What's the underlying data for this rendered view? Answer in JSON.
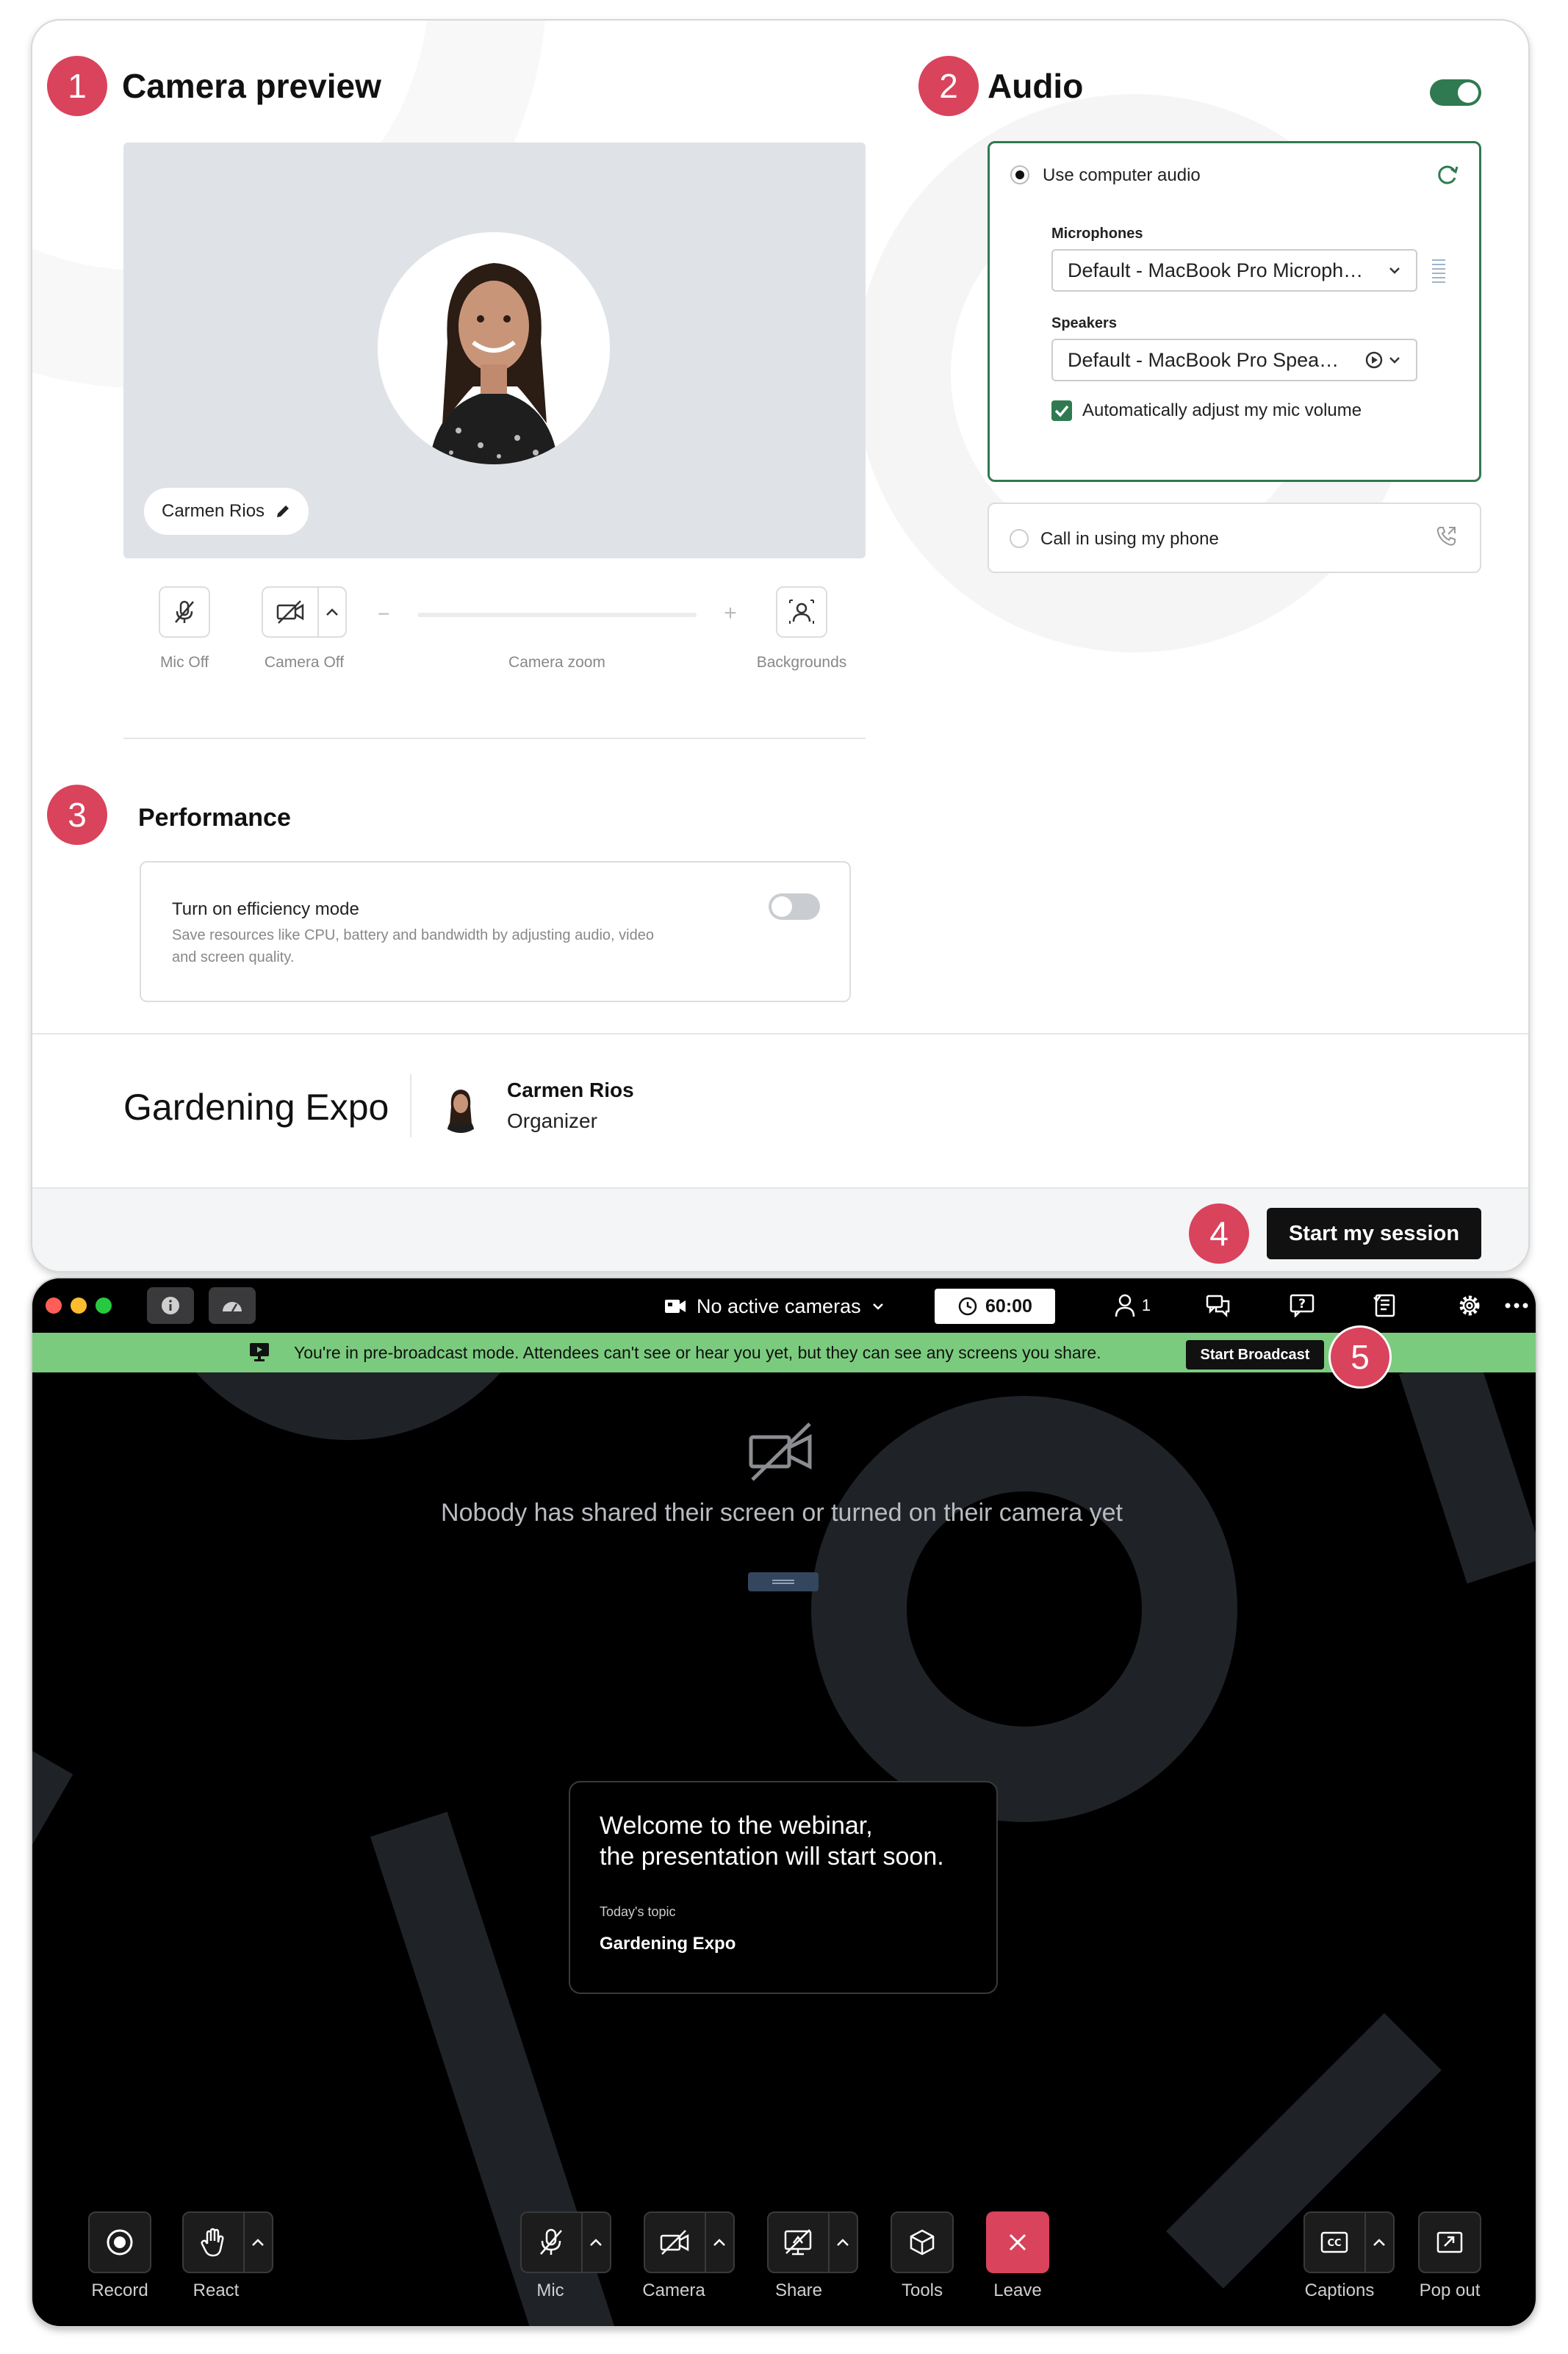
{
  "camera": {
    "badge": "1",
    "title": "Camera preview",
    "name": "Carmen Rios",
    "mic_label": "Mic Off",
    "camera_label": "Camera Off",
    "zoom_label": "Camera zoom",
    "zoom_minus": "−",
    "zoom_plus": "+",
    "backgrounds_label": "Backgrounds"
  },
  "audio": {
    "badge": "2",
    "title": "Audio",
    "enabled": true,
    "use_computer_audio": "Use computer audio",
    "microphones_label": "Microphones",
    "microphone_value": "Default - MacBook Pro Microph…",
    "speakers_label": "Speakers",
    "speaker_value": "Default - MacBook Pro Spea…",
    "auto_adjust": "Automatically adjust my mic volume",
    "auto_adjust_checked": true,
    "call_in": "Call in using my phone"
  },
  "performance": {
    "badge": "3",
    "title": "Performance",
    "mode_title": "Turn on efficiency mode",
    "mode_desc_1": "Save resources like CPU, battery and bandwidth by adjusting audio, video",
    "mode_desc_2": "and screen quality.",
    "enabled": false
  },
  "event": {
    "title": "Gardening Expo",
    "host_name": "Carmen Rios",
    "host_role": "Organizer"
  },
  "session": {
    "badge": "4",
    "start_label": "Start my session"
  },
  "meeting": {
    "cameras": "No active cameras",
    "timer": "60:00",
    "participants": "1",
    "banner_text": "You're in pre-broadcast mode. Attendees can't see or hear you yet, but they can see any screens you share.",
    "start_broadcast": "Start Broadcast",
    "badge": "5",
    "empty_text": "Nobody has shared their screen or turned on their camera yet",
    "welcome_line1": "Welcome to the webinar,",
    "welcome_line2": "the presentation will start soon.",
    "topic_label": "Today's topic",
    "topic": "Gardening Expo"
  },
  "toolbar": {
    "record": "Record",
    "react": "React",
    "mic": "Mic",
    "camera": "Camera",
    "share": "Share",
    "tools": "Tools",
    "leave": "Leave",
    "captions": "Captions",
    "popout": "Pop out"
  },
  "colors": {
    "badge": "#d9435c",
    "accent_green": "#2f7a50",
    "banner_green": "#7bcb7e",
    "leave_red": "#d9435c"
  }
}
